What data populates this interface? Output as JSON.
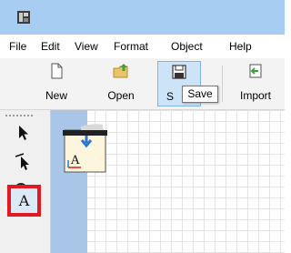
{
  "menu": {
    "file": "File",
    "edit": "Edit",
    "view": "View",
    "format": "Format",
    "object": "Object",
    "help": "Help"
  },
  "toolbar": {
    "new_label": "New",
    "open_label": "Open",
    "save_label": "S",
    "import_label": "Import"
  },
  "tooltip": {
    "text": "Save"
  },
  "toolbox": {
    "text_tool_label": "A",
    "highlight_color": "#e11a22"
  },
  "colors": {
    "titlebar": "#a8cdf2",
    "accent_blue": "#2b78d0",
    "accent_green": "#3aa639"
  }
}
